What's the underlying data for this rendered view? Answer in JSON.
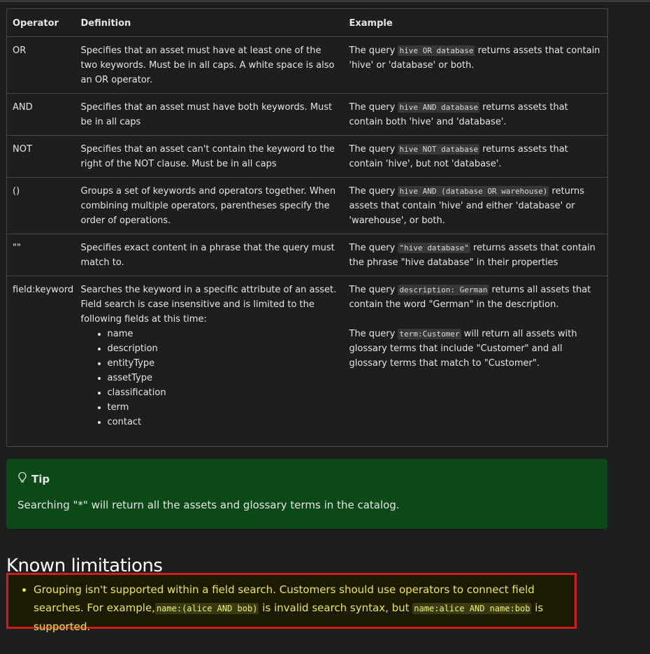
{
  "table": {
    "headers": [
      "Operator",
      "Definition",
      "Example"
    ],
    "rows": [
      {
        "operator": "OR",
        "definition": "Specifies that an asset must have at least one of the two keywords. Must be in all caps. A white space is also an OR operator.",
        "example_pre": "The query ",
        "example_code": "hive OR database",
        "example_post": " returns assets that contain 'hive' or 'database' or both."
      },
      {
        "operator": "AND",
        "definition": "Specifies that an asset must have both keywords. Must be in all caps",
        "example_pre": "The query ",
        "example_code": "hive AND database",
        "example_post": " returns assets that contain both 'hive' and 'database'."
      },
      {
        "operator": "NOT",
        "definition": "Specifies that an asset can't contain the keyword to the right of the NOT clause. Must be in all caps",
        "example_pre": "The query ",
        "example_code": "hive NOT database",
        "example_post": " returns assets that contain 'hive', but not 'database'."
      },
      {
        "operator": "()",
        "definition": "Groups a set of keywords and operators together. When combining multiple operators, parentheses specify the order of operations.",
        "example_pre": "The query ",
        "example_code": "hive AND (database OR warehouse)",
        "example_post": " returns assets that contain 'hive' and either 'database' or 'warehouse', or both."
      },
      {
        "operator": "\"\"",
        "definition": "Specifies exact content in a phrase that the query must match to.",
        "example_pre": "The query ",
        "example_code": "\"hive database\"",
        "example_post": " returns assets that contain the phrase \"hive database\" in their properties"
      },
      {
        "operator": "field:keyword",
        "definition": "Searches the keyword in a specific attribute of an asset. Field search is case insensitive and is limited to the following fields at this time:",
        "fields": [
          "name",
          "description",
          "entityType",
          "assetType",
          "classification",
          "term",
          "contact"
        ],
        "example_pre": "The query ",
        "example_code": "description: German",
        "example_post": " returns all assets that contain the word \"German\" in the description.",
        "example2_pre": "The query ",
        "example2_code": "term:Customer",
        "example2_post": " will return all assets with glossary terms that include \"Customer\" and all glossary terms that match to \"Customer\"."
      }
    ]
  },
  "tip": {
    "icon": "lightbulb-icon",
    "title": "Tip",
    "text": "Searching \"*\" will return all the assets and glossary terms in the catalog."
  },
  "limitations": {
    "heading": "Known limitations",
    "item_pre": "Grouping isn't supported within a field search. Customers should use operators to connect field searches. For example,",
    "item_code1": "name:(alice AND bob)",
    "item_mid": " is invalid search syntax, but ",
    "item_code2": "name:alice AND name:bob",
    "item_post": " is supported."
  },
  "colors": {
    "background": "#1e1e1e",
    "tip_background": "#0b4a16",
    "highlight_border": "#d11c1c",
    "highlight_text": "#e8e84a"
  }
}
